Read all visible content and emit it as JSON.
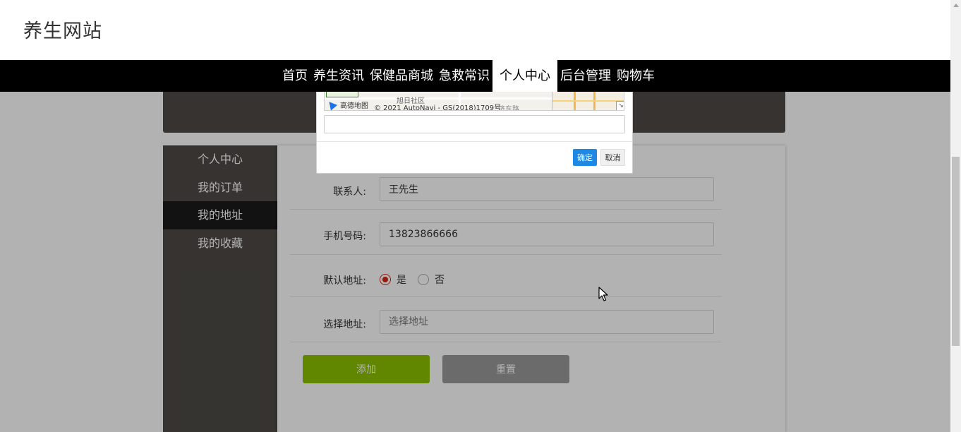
{
  "header": {
    "site_title": "养生网站"
  },
  "nav": {
    "items": [
      {
        "label": "首页"
      },
      {
        "label": "养生资讯"
      },
      {
        "label": "保健品商城"
      },
      {
        "label": "急救常识"
      },
      {
        "label": "个人中心",
        "active": true
      },
      {
        "label": "后台管理"
      },
      {
        "label": "购物车"
      }
    ]
  },
  "sidebar": {
    "items": [
      {
        "label": "个人中心"
      },
      {
        "label": "我的订单"
      },
      {
        "label": "我的地址",
        "active": true
      },
      {
        "label": "我的收藏"
      }
    ]
  },
  "form": {
    "contact_label": "联系人:",
    "contact_value": "王先生",
    "phone_label": "手机号码:",
    "phone_value": "13823866666",
    "default_label": "默认地址:",
    "default_yes": "是",
    "default_no": "否",
    "default_selected": "是",
    "address_label": "选择地址:",
    "address_placeholder": "选择地址",
    "add_button": "添加",
    "reset_button": "重置"
  },
  "dialog": {
    "map_logo": "高德地图",
    "map_copyright": "© 2021 AutoNavi - GS(2018)1709号",
    "map_place": "旭日社区",
    "map_road": "济东路",
    "ok_button": "确定",
    "cancel_button": "取消"
  },
  "colors": {
    "accent_add": "#8bc100",
    "dialog_ok": "#1e88e5",
    "radio_checked": "#d9230f",
    "sidebar_bg": "#4e4a45"
  }
}
